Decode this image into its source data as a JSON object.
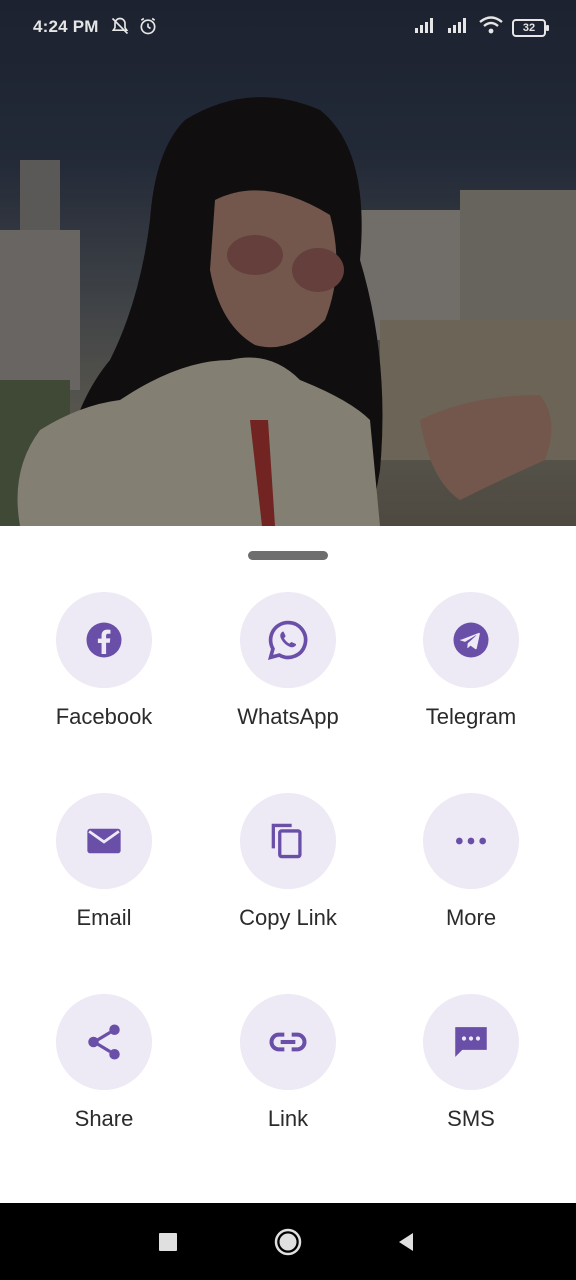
{
  "status_bar": {
    "time": "4:24 PM",
    "icons": [
      "bell-off-icon",
      "alarm-icon"
    ],
    "right_icons": [
      "signal-icon",
      "signal-icon",
      "wifi-icon"
    ],
    "battery": "32"
  },
  "background": {
    "description_icon": "photo"
  },
  "share_sheet": {
    "accent_color": "#6a4fa8",
    "tile_color": "#ede9f5",
    "items": [
      {
        "label": "Facebook",
        "icon": "facebook-icon"
      },
      {
        "label": "WhatsApp",
        "icon": "whatsapp-icon"
      },
      {
        "label": "Telegram",
        "icon": "telegram-icon"
      },
      {
        "label": "Email",
        "icon": "email-icon"
      },
      {
        "label": "Copy Link",
        "icon": "copy-icon"
      },
      {
        "label": "More",
        "icon": "more-icon"
      },
      {
        "label": "Share",
        "icon": "share-icon"
      },
      {
        "label": "Link",
        "icon": "link-icon"
      },
      {
        "label": "SMS",
        "icon": "sms-icon"
      }
    ]
  },
  "nav_bar": {
    "buttons": [
      "recents-icon",
      "home-icon",
      "back-icon"
    ]
  }
}
